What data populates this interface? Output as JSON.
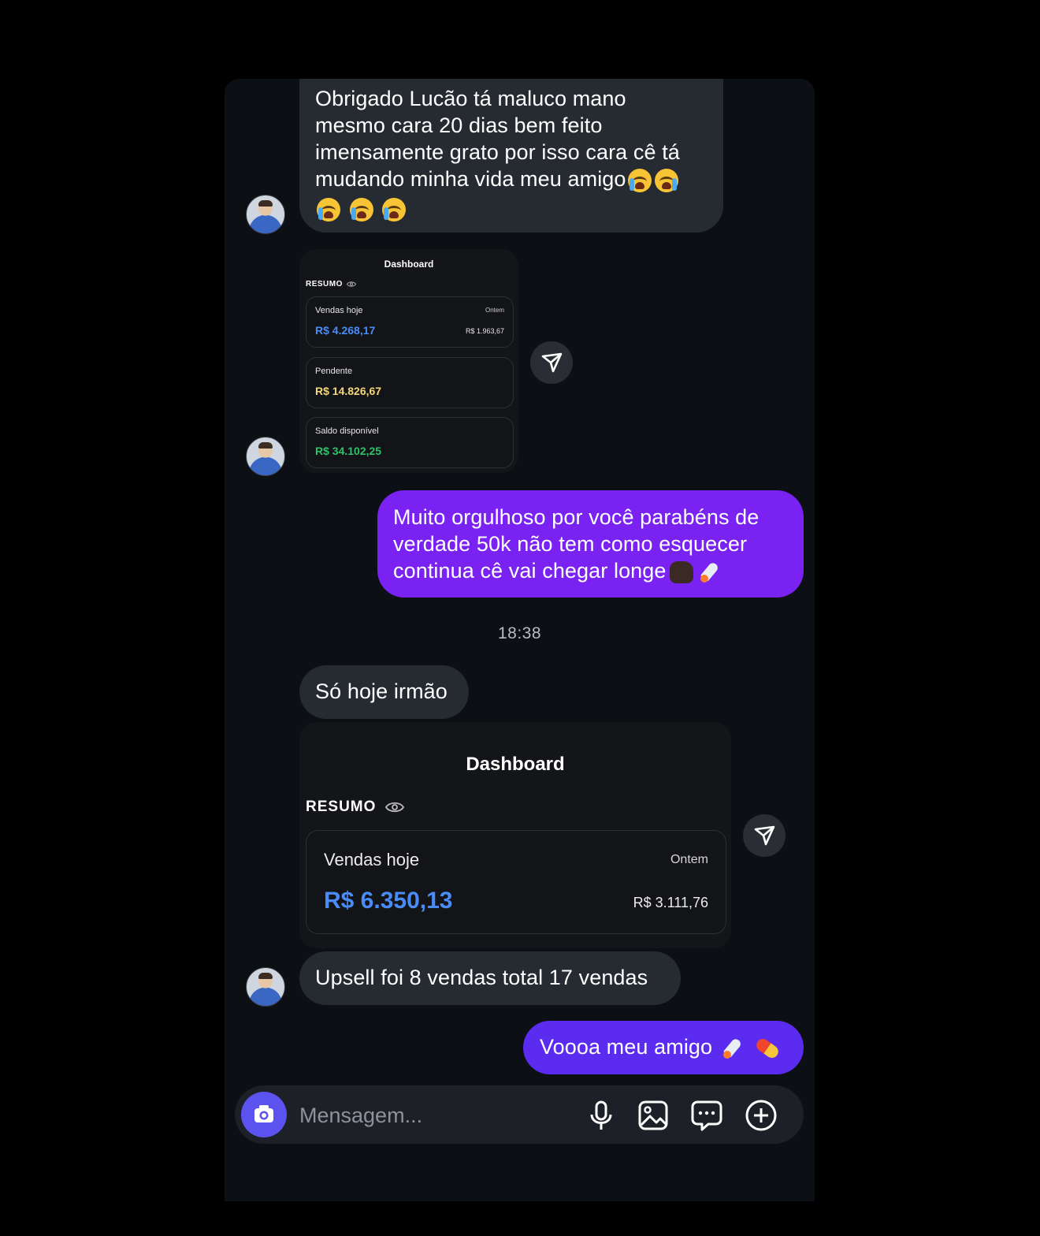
{
  "messages": {
    "m1_lines": [
      "Obrigado Lucão tá maluco mano",
      "mesmo cara 20 dias bem feito",
      "imensamente grato por isso cara cê tá",
      "mudando minha vida meu amigo"
    ],
    "m1_emojis": [
      "crying-face",
      "crying-face",
      "crying-face",
      "crying-face",
      "crying-face"
    ],
    "m2_lines": [
      "Muito orgulhoso por você parabéns de",
      "verdade 50k  não tem como esquecer",
      "continua cê vai chegar longe"
    ],
    "m2_emojis": [
      "fist",
      "rocket"
    ],
    "time": "18:38",
    "m3": "Só hoje irmão",
    "m4": "Upsell foi 8 vendas total 17 vendas",
    "m5": "Voooa meu amigo",
    "m5_emojis": [
      "rocket",
      "pill"
    ]
  },
  "dash_small": {
    "title": "Dashboard",
    "resumo": "RESUMO",
    "vendas_label": "Vendas hoje",
    "vendas_value": "R$ 4.268,17",
    "ontem_label": "Ontem",
    "ontem_value": "R$ 1.963,67",
    "pendente_label": "Pendente",
    "pendente_value": "R$ 14.826,67",
    "saldo_label": "Saldo disponível",
    "saldo_value": "R$ 34.102,25"
  },
  "dash_large": {
    "title": "Dashboard",
    "resumo": "RESUMO",
    "vendas_label": "Vendas hoje",
    "vendas_value": "R$ 6.350,13",
    "ontem_label": "Ontem",
    "ontem_value": "R$ 3.111,76"
  },
  "composer": {
    "placeholder": "Mensagem...",
    "icons": [
      "camera-icon",
      "microphone-icon",
      "gallery-icon",
      "sticker-icon",
      "plus-icon"
    ]
  },
  "colors": {
    "outgoing_bubble": "#7a22f2",
    "incoming_bubble": "#262a31",
    "blue_value": "#4a8cf7",
    "yellow_value": "#f3d87a",
    "green_value": "#2fc26a",
    "camera_button": "#5b52f0"
  }
}
